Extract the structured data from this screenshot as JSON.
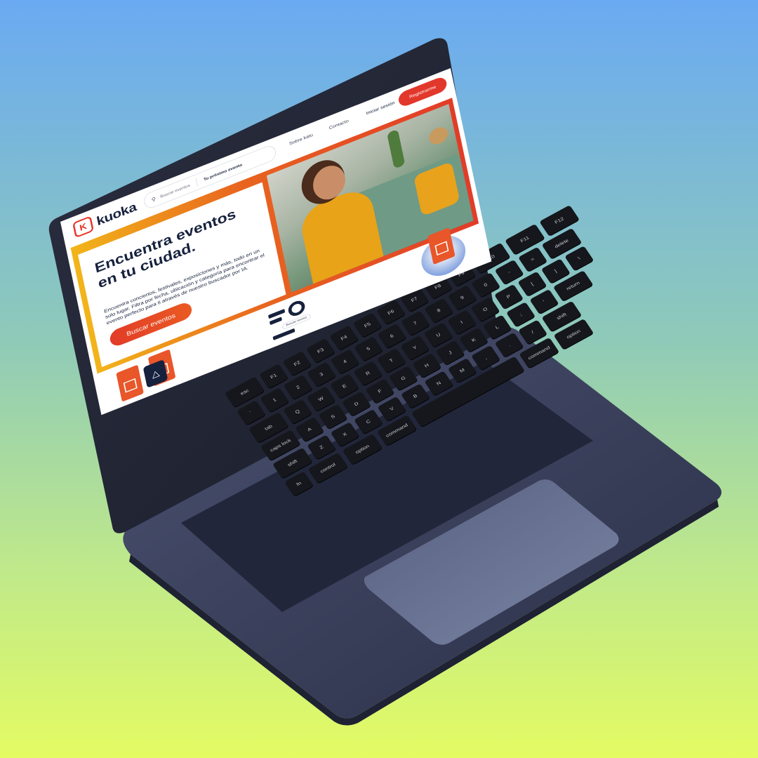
{
  "app": {
    "brand": "kuoka",
    "logo_letter": "K",
    "accent_color": "#e2372b",
    "navy_color": "#16213d"
  },
  "nav": {
    "search_placeholder": "Buscar eventos",
    "search_next": "Tu próximo evento",
    "links": [
      "Sobre katu",
      "Contacto"
    ],
    "login_label": "Iniciar sesión",
    "register_label": "Registrarme"
  },
  "hero": {
    "title": "Encuentra eventos en tu ciudad.",
    "description": "Encuentra conciertos, festivales, exposiciones y más, todo en un solo lugar. Filtra por fecha, ubicación y categoría para encontrar el evento perfecto para ti através de nuestro buscador por IA.",
    "cta_label": "Buscar eventos"
  },
  "illustration": {
    "chip_label": "Buscar evento"
  },
  "keyboard": {
    "rows": [
      [
        "esc",
        "F1",
        "F2",
        "F3",
        "F4",
        "F5",
        "F6",
        "F7",
        "F8",
        "F9",
        "F10",
        "F11",
        "F12"
      ],
      [
        "`",
        "1",
        "2",
        "3",
        "4",
        "5",
        "6",
        "7",
        "8",
        "9",
        "0",
        "-",
        "=",
        "delete"
      ],
      [
        "tab",
        "Q",
        "W",
        "E",
        "R",
        "T",
        "Y",
        "U",
        "I",
        "O",
        "P",
        "[",
        "]",
        "\\"
      ],
      [
        "caps lock",
        "A",
        "S",
        "D",
        "F",
        "G",
        "H",
        "J",
        "K",
        "L",
        ";",
        "'",
        "return"
      ],
      [
        "shift",
        "Z",
        "X",
        "C",
        "V",
        "B",
        "N",
        "M",
        ",",
        ".",
        "/",
        "shift"
      ],
      [
        "fn",
        "control",
        "option",
        "command",
        "",
        "command",
        "option"
      ]
    ]
  }
}
